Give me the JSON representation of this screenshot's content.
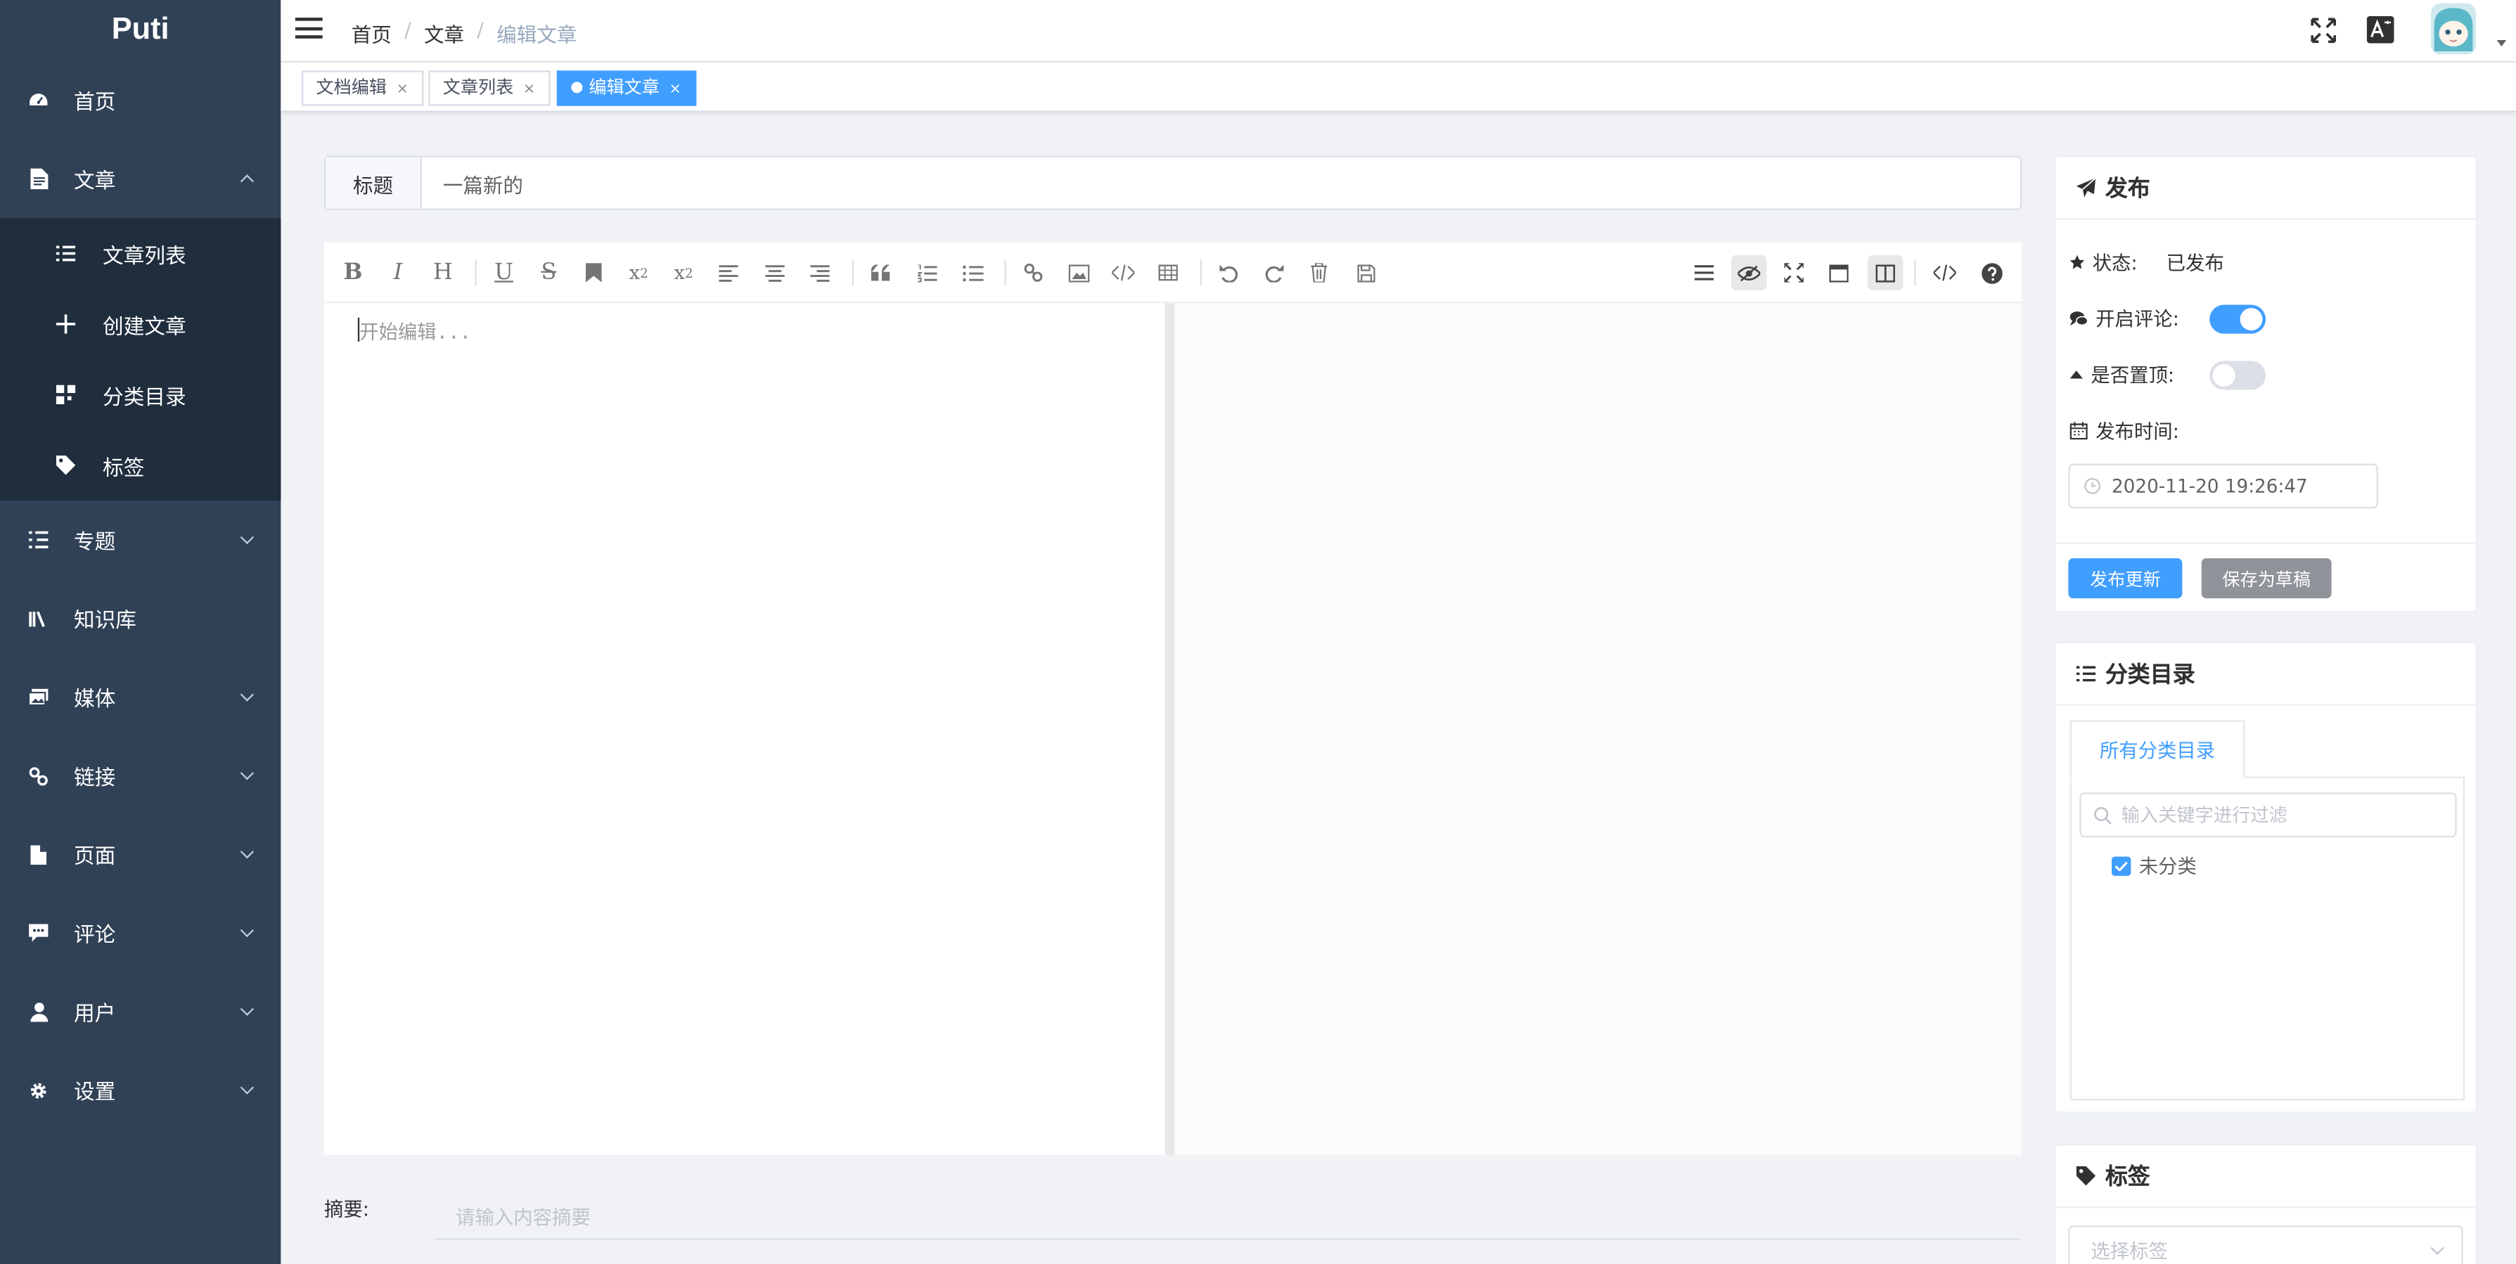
{
  "sidebar": {
    "logo": "Puti",
    "items": [
      {
        "label": "首页",
        "icon": "dashboard-icon"
      },
      {
        "label": "文章",
        "icon": "document-icon",
        "expanded": true
      },
      {
        "label": "专题",
        "icon": "list-icon"
      },
      {
        "label": "知识库",
        "icon": "books-icon"
      },
      {
        "label": "媒体",
        "icon": "image-icon"
      },
      {
        "label": "链接",
        "icon": "link-icon"
      },
      {
        "label": "页面",
        "icon": "page-icon"
      },
      {
        "label": "评论",
        "icon": "comment-icon"
      },
      {
        "label": "用户",
        "icon": "user-icon"
      },
      {
        "label": "设置",
        "icon": "gear-icon"
      }
    ],
    "submenu": [
      {
        "label": "文章列表",
        "icon": "list-icon"
      },
      {
        "label": "创建文章",
        "icon": "plus-icon"
      },
      {
        "label": "分类目录",
        "icon": "category-icon"
      },
      {
        "label": "标签",
        "icon": "tag-icon"
      }
    ]
  },
  "breadcrumb": [
    "首页",
    "文章",
    "编辑文章"
  ],
  "tags_view": [
    {
      "label": "文档编辑"
    },
    {
      "label": "文章列表"
    },
    {
      "label": "编辑文章",
      "active": true
    }
  ],
  "editor": {
    "title_label": "标题",
    "title_value": "一篇新的",
    "placeholder": "开始编辑...",
    "summary_label": "摘要:",
    "summary_placeholder": "请输入内容摘要"
  },
  "publish": {
    "heading": "发布",
    "status_label": "状态:",
    "status_value": "已发布",
    "comment_label": "开启评论:",
    "comment_enabled": true,
    "sticky_label": "是否置顶:",
    "sticky_enabled": false,
    "time_label": "发布时间:",
    "time_value": "2020-11-20 19:26:47",
    "publish_button": "发布更新",
    "draft_button": "保存为草稿"
  },
  "category": {
    "heading": "分类目录",
    "tab": "所有分类目录",
    "filter_placeholder": "输入关键字进行过滤",
    "items": [
      {
        "label": "未分类",
        "checked": true
      }
    ]
  },
  "tags_card": {
    "heading": "标签",
    "placeholder": "选择标签"
  },
  "colors": {
    "sidebar_bg": "#304156",
    "submenu_bg": "#1f2d3d",
    "primary": "#409eff",
    "draft_button": "#909399"
  }
}
